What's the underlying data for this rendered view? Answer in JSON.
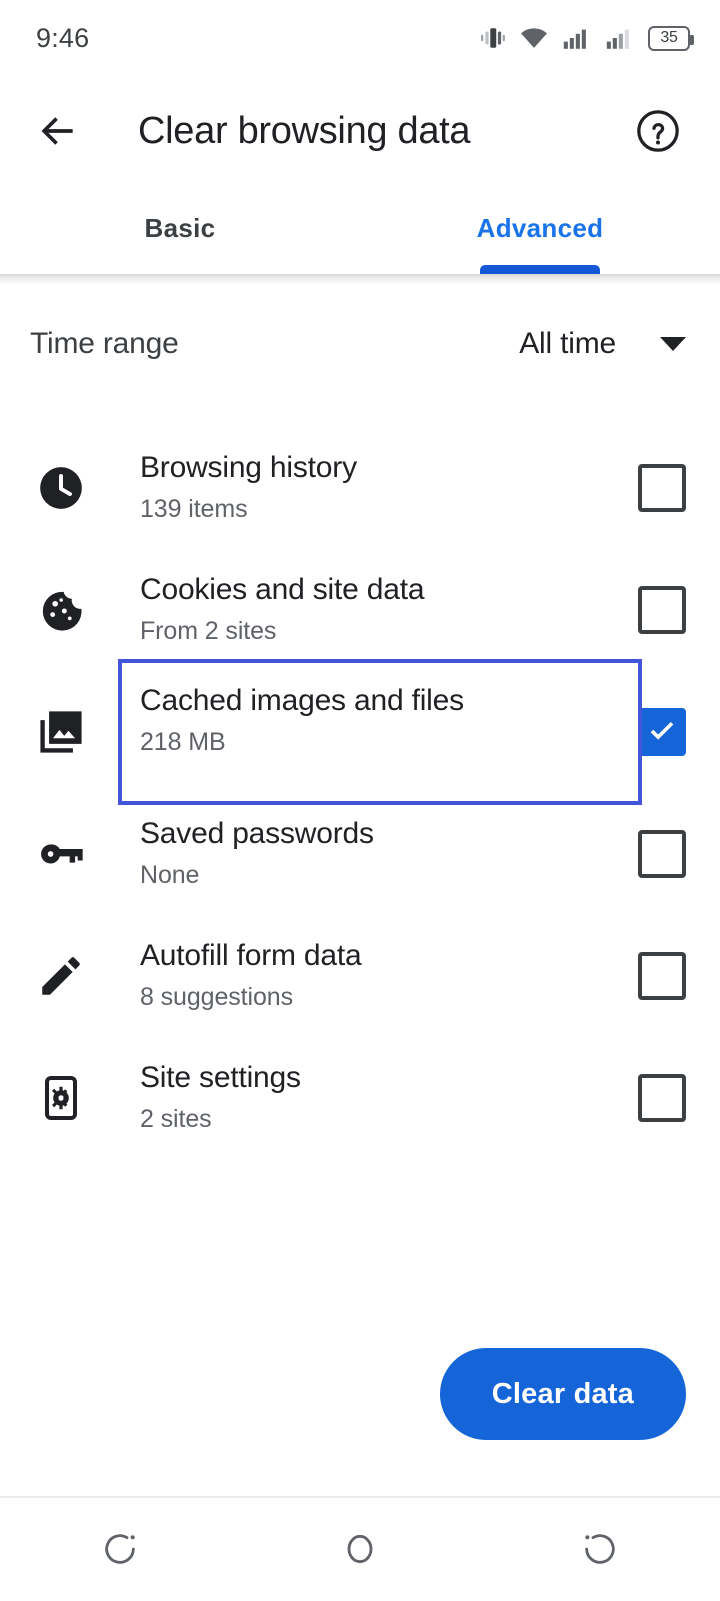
{
  "status_bar": {
    "time": "9:46",
    "icons": [
      "vibrate-icon",
      "wifi-icon",
      "signal-icon",
      "signal-icon-2",
      "battery-icon"
    ],
    "battery_level": "35"
  },
  "toolbar": {
    "back_icon": "arrow-back-icon",
    "title": "Clear browsing data",
    "help_icon": "help-circle-icon"
  },
  "tabs": {
    "items": [
      {
        "label": "Basic",
        "active": false
      },
      {
        "label": "Advanced",
        "active": true
      }
    ],
    "active_color": "#1a73e8",
    "indicator_color": "#1558d6"
  },
  "time_range": {
    "label": "Time range",
    "value": "All time",
    "caret_icon": "chevron-down-icon"
  },
  "data_types": [
    {
      "icon": "clock-icon",
      "title": "Browsing history",
      "subtitle": "139 items",
      "checked": false,
      "focused": false
    },
    {
      "icon": "cookie-icon",
      "title": "Cookies and site data",
      "subtitle": "From 2 sites",
      "checked": false,
      "focused": false
    },
    {
      "icon": "photo-library-icon",
      "title": "Cached images and files",
      "subtitle": "218 MB",
      "checked": true,
      "focused": true
    },
    {
      "icon": "key-icon",
      "title": "Saved passwords",
      "subtitle": "None",
      "checked": false,
      "focused": false
    },
    {
      "icon": "pencil-icon",
      "title": "Autofill form data",
      "subtitle": "8 suggestions",
      "checked": false,
      "focused": false
    },
    {
      "icon": "site-settings-icon",
      "title": "Site settings",
      "subtitle": "2 sites",
      "checked": false,
      "focused": false
    }
  ],
  "footer": {
    "clear_button_label": "Clear data",
    "clear_button_color": "#1565d8"
  },
  "nav_bar": {
    "recents_icon": "recents-arc-icon",
    "home_icon": "home-circle-icon",
    "back_icon": "back-arc-icon"
  },
  "colors": {
    "accent_blue": "#1a73e8",
    "focus_outline": "#4355d9",
    "text_primary": "#202124",
    "text_secondary": "#5f6368"
  }
}
